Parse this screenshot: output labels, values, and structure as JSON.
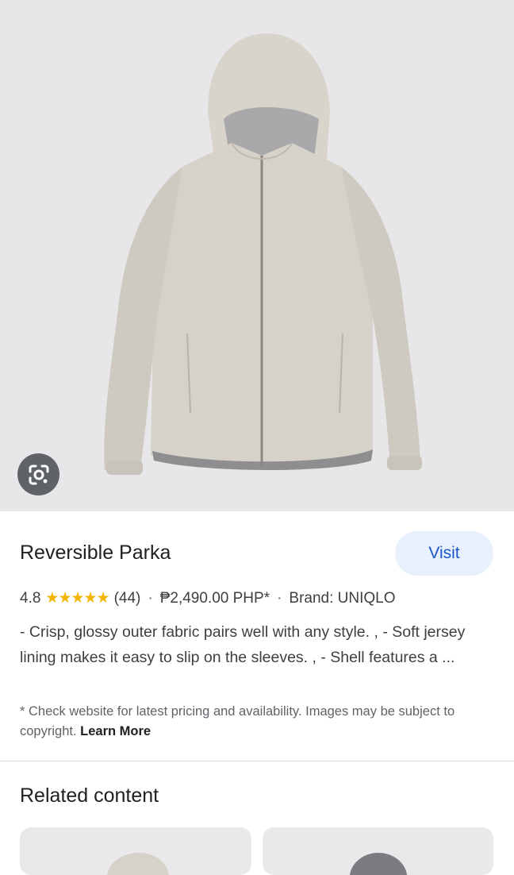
{
  "product": {
    "title": "Reversible Parka",
    "visit_label": "Visit",
    "rating": "4.8",
    "stars": "★★★★★",
    "review_count": "(44)",
    "separator": "·",
    "price": "₱2,490.00 PHP*",
    "brand": "Brand: UNIQLO",
    "description": "- Crisp, glossy outer fabric pairs well with any style. , - Soft jersey lining makes it easy to slip on the sleeves. , - Shell features a ...",
    "disclaimer": "* Check website for latest pricing and availability. Images may be subject to copyright.",
    "learn_more": "Learn More"
  },
  "related": {
    "title": "Related content"
  },
  "icons": {
    "lens": "google-lens-icon"
  },
  "colors": {
    "accent": "#1a56c8",
    "visit_bg": "#e8f0fe",
    "star": "#f4b400",
    "jacket": "#d6d1c9"
  }
}
